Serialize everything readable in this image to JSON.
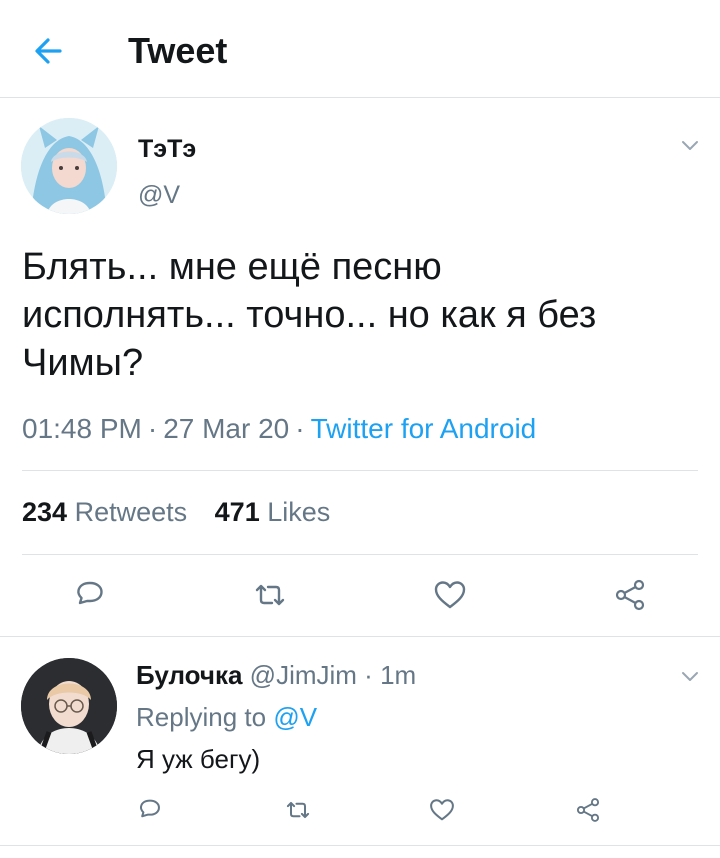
{
  "header": {
    "title": "Tweet",
    "back_icon": "arrow-left-icon"
  },
  "colors": {
    "accent": "#1da1f2",
    "text": "#14171a",
    "secondary": "#657786",
    "divider": "#dfe3e6"
  },
  "tweet": {
    "display_name": "ТэТэ",
    "handle": "@V",
    "text_lines": [
      "Блять... мне ещё песню",
      "исполнять... точно... но как я без",
      "Чимы?"
    ],
    "time": "01:48 PM",
    "date": "27 Mar 20",
    "separator": "·",
    "source": "Twitter for Android",
    "retweet_count": "234",
    "retweet_label": "Retweets",
    "like_count": "471",
    "like_label": "Likes",
    "actions": [
      "reply-icon",
      "retweet-icon",
      "like-icon",
      "share-icon"
    ]
  },
  "reply": {
    "display_name": "Булочка",
    "handle": "@JimJim",
    "separator": "·",
    "time": "1m",
    "replying_label": "Replying to",
    "replying_to": "@V",
    "text": "Я уж бегу)",
    "actions": [
      "reply-icon",
      "retweet-icon",
      "like-icon",
      "share-icon"
    ]
  }
}
